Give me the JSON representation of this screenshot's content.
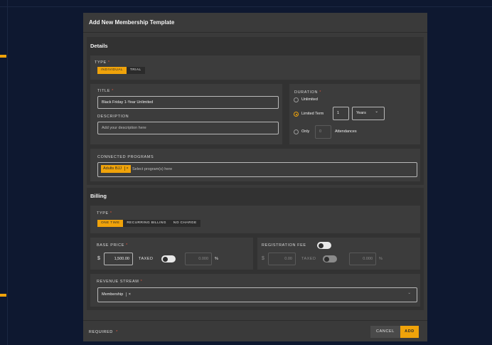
{
  "modal": {
    "title": "Add New Membership Template"
  },
  "details": {
    "section_title": "Details",
    "type": {
      "label": "TYPE",
      "required_mark": "*",
      "options": [
        "INDIVIDUAL",
        "TRIAL"
      ],
      "selected": "INDIVIDUAL"
    },
    "title": {
      "label": "TITLE",
      "required_mark": "*",
      "value": "Black Friday 1-Year Unlimited"
    },
    "description": {
      "label": "DESCRIPTION",
      "placeholder": "Add your description here"
    },
    "duration": {
      "label": "DURATION",
      "required_mark": "*",
      "options": {
        "unlimited": "Unlimited",
        "limited_term": "Limited Term",
        "only": "Only"
      },
      "selected": "limited_term",
      "term_value": "1",
      "term_unit": "Years",
      "term_unit_arrow": "⌄",
      "attendance_value": "0",
      "attendance_label": "Attendances"
    },
    "connected_programs": {
      "label": "CONNECTED PROGRAMS",
      "chips": [
        "Adults BJJ"
      ],
      "chip_remove": "×",
      "placeholder": "Select program(s) here"
    }
  },
  "billing": {
    "section_title": "Billing",
    "type": {
      "label": "TYPE",
      "required_mark": "*",
      "options": [
        "ONE TIME",
        "RECURRING BILLING",
        "NO CHARGE"
      ],
      "selected": "ONE TIME"
    },
    "base_price": {
      "label": "BASE PRICE",
      "required_mark": "*",
      "currency": "$",
      "value": "1,500.00",
      "taxed_label": "TAXED",
      "taxed_on": false,
      "tax_value": "0.000",
      "percent": "%"
    },
    "registration_fee": {
      "label": "REGISTRATION FEE",
      "enabled": false,
      "currency": "$",
      "value": "0.00",
      "taxed_label": "TAXED",
      "tax_value": "0.000",
      "percent": "%"
    },
    "revenue_stream": {
      "label": "REVENUE STREAM",
      "required_mark": "*",
      "value": "Membership",
      "remove": "×",
      "arrow": "⌄"
    }
  },
  "footer": {
    "required_label": "REQUIRED",
    "required_mark": "*",
    "cancel_label": "CANCEL",
    "add_label": "ADD"
  },
  "colors": {
    "accent": "#f0a30a",
    "required": "#e0523b",
    "background": "#0e1830",
    "panel": "#3a3a3a"
  }
}
